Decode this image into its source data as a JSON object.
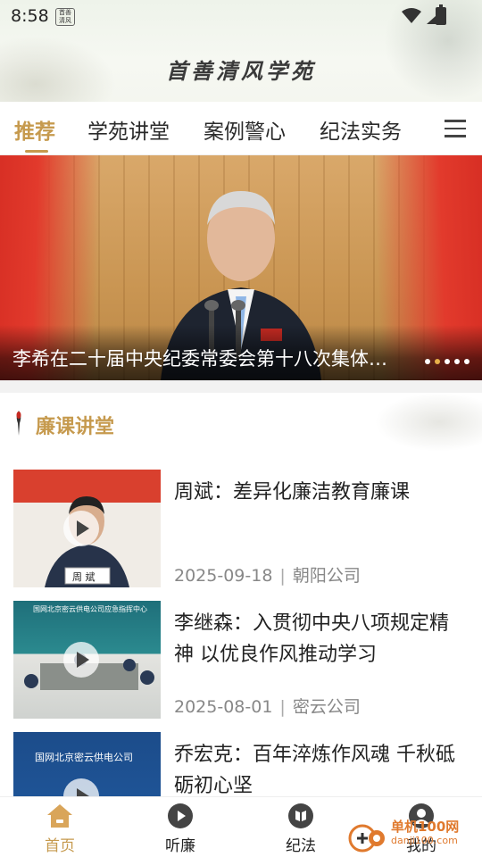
{
  "status_bar": {
    "time": "8:58",
    "notification_badge": "..."
  },
  "header": {
    "app_title": "首善清风学苑"
  },
  "tabs": [
    {
      "label": "推荐",
      "active": true
    },
    {
      "label": "学苑讲堂"
    },
    {
      "label": "案例警心"
    },
    {
      "label": "纪法实务"
    }
  ],
  "banner": {
    "caption": "李希在二十届中央纪委常委会第十八次集体学习时强调",
    "slide_count": 5,
    "active_slide": 1
  },
  "section": {
    "title": "廉课讲堂"
  },
  "articles": [
    {
      "title": "周斌：差异化廉洁教育廉课",
      "date": "2025-09-18",
      "unit": "朝阳公司",
      "thumb_caption": "周 斌"
    },
    {
      "title": " 李继森：入贯彻中央八项规定精神 以优良作风推动学习",
      "date": "2025-08-01",
      "unit": "密云公司",
      "thumb_caption": "国网北京密云供电公司应急指挥中心"
    },
    {
      "title": "乔宏克：百年淬炼作风魂 千秋砥砺初心坚",
      "date": "",
      "unit": "",
      "thumb_caption": "国网北京密云供电公司"
    }
  ],
  "bottom_nav": [
    {
      "label": "首页",
      "icon": "home-icon",
      "active": true
    },
    {
      "label": "听廉",
      "icon": "play-circle-icon"
    },
    {
      "label": "纪法",
      "icon": "book-icon"
    },
    {
      "label": "我的",
      "icon": "user-icon"
    }
  ],
  "watermark": {
    "text": "单机100网",
    "sub": "danji100.com"
  },
  "colors": {
    "accent": "#c69a4e",
    "banner_red": "#d62b22"
  }
}
